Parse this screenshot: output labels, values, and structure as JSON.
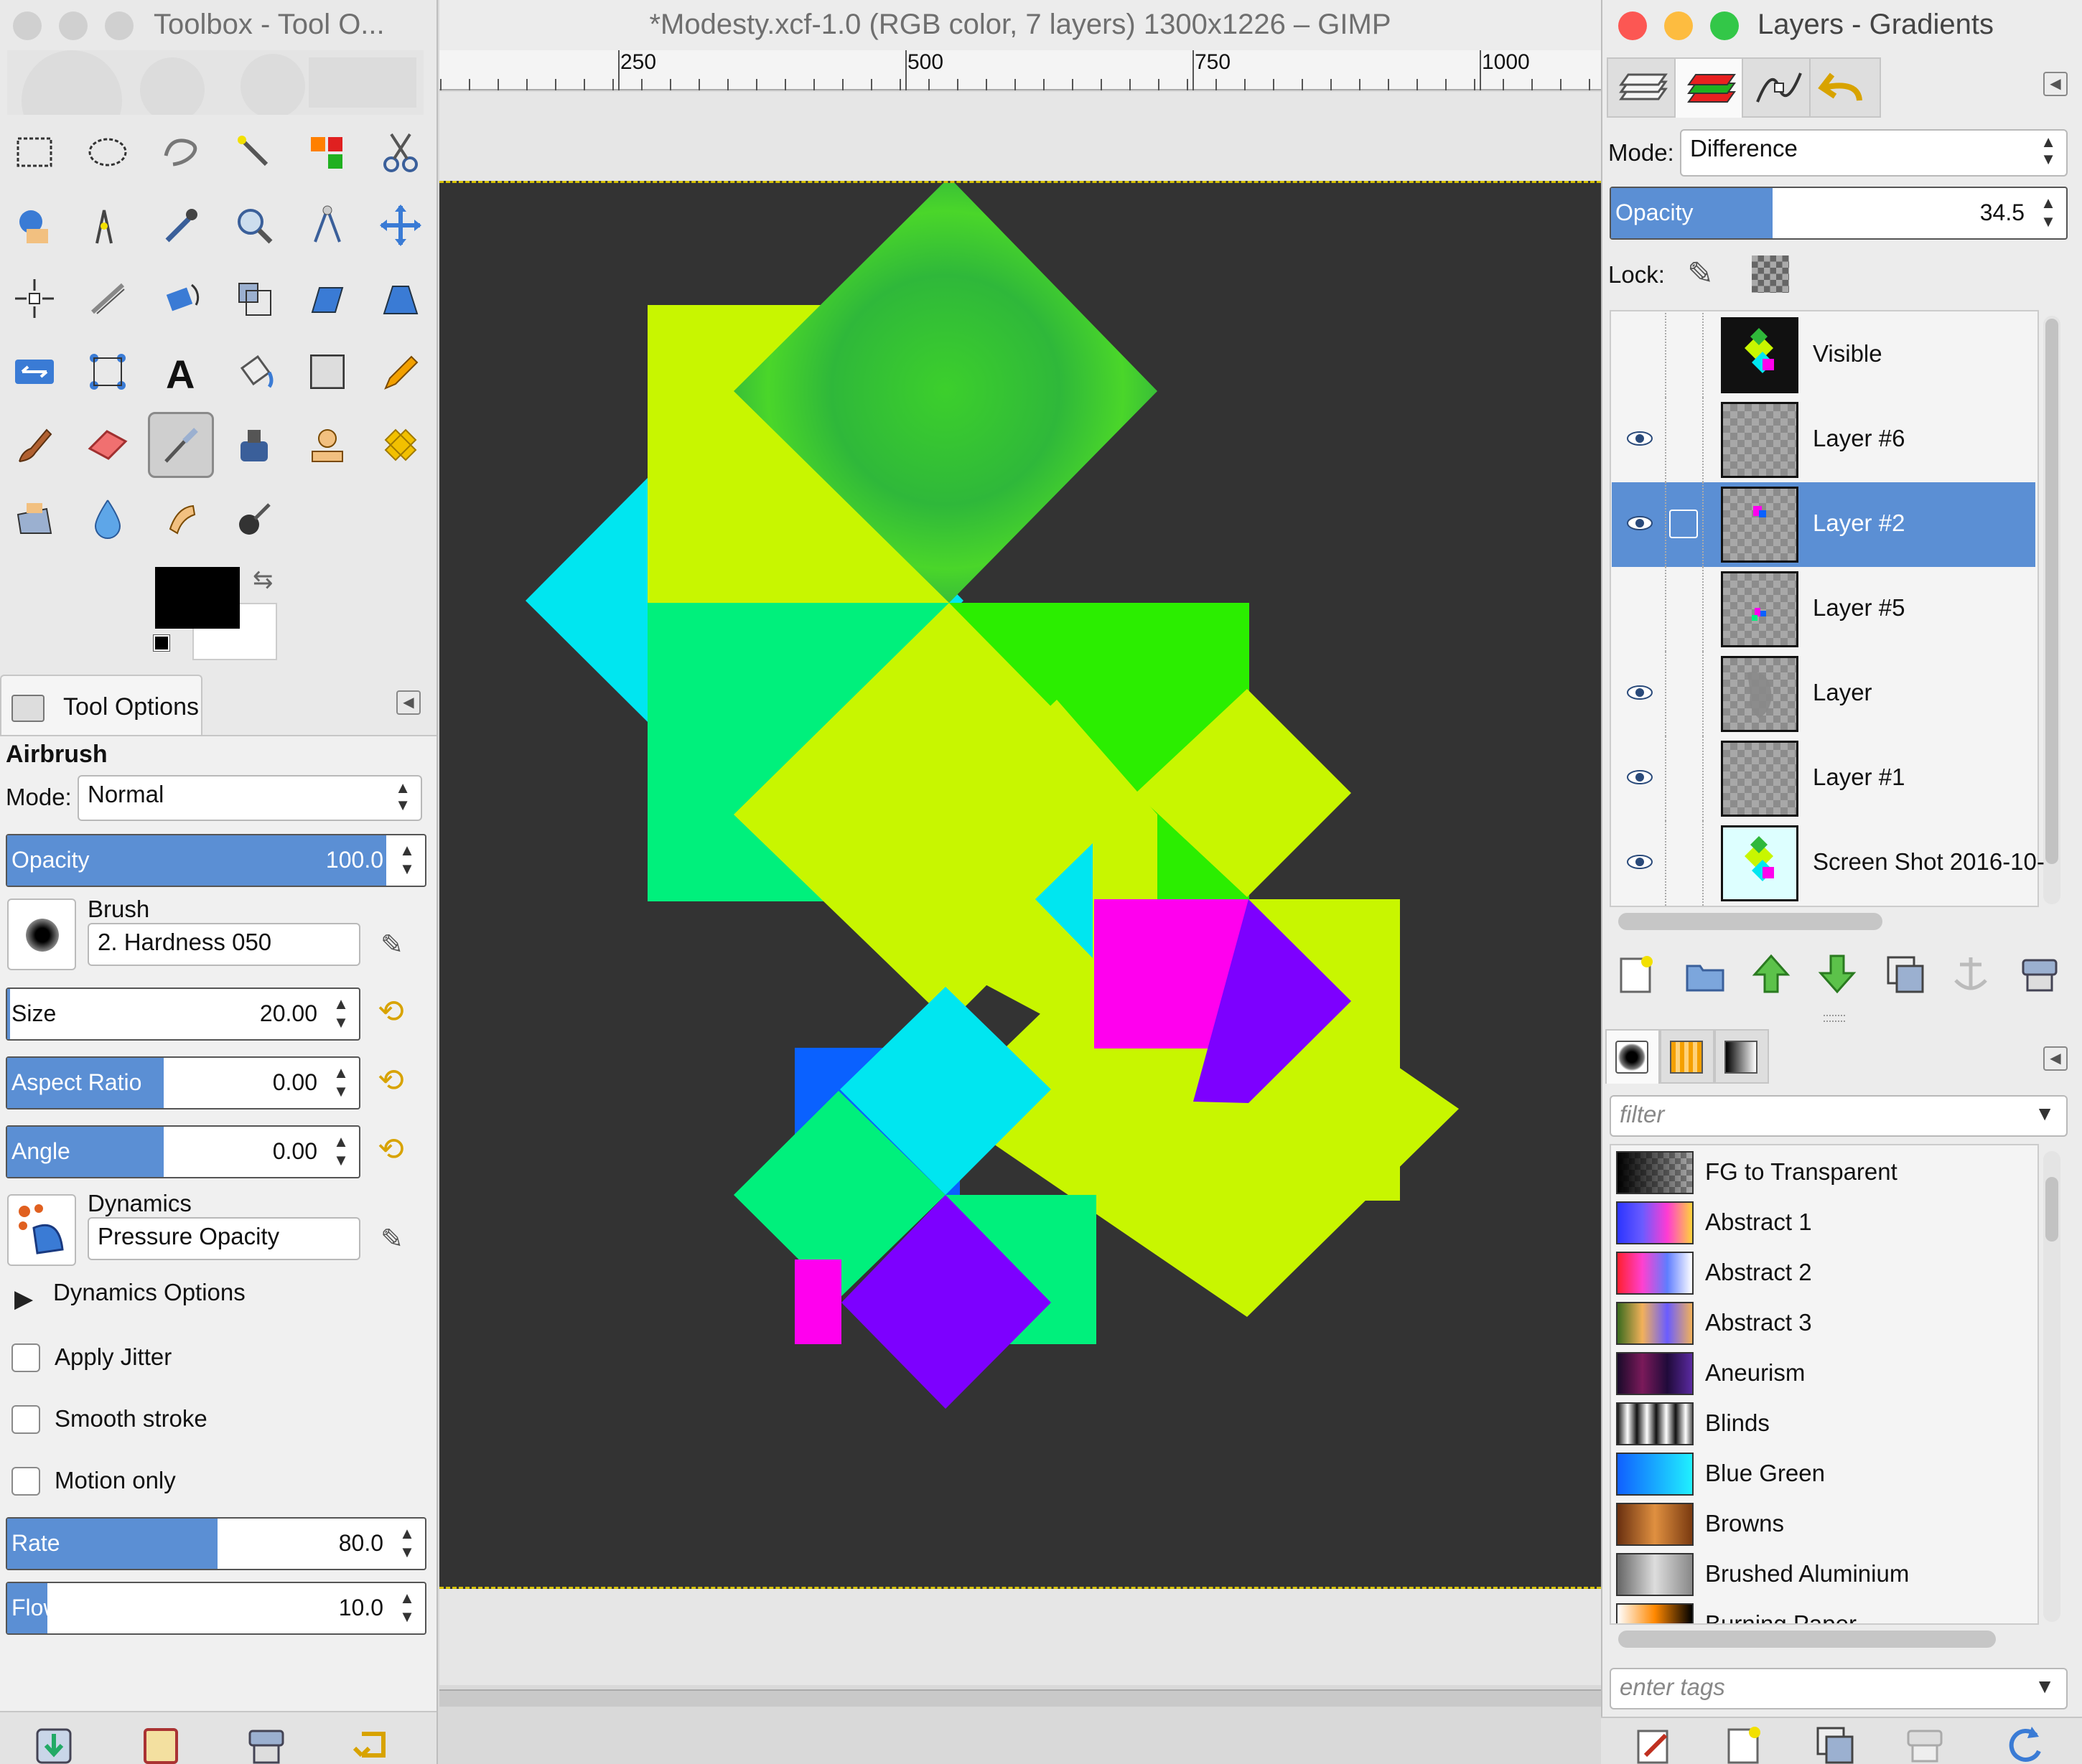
{
  "toolbox": {
    "title": "Toolbox - Tool O...",
    "tool_options_tab": "Tool Options",
    "tool_name": "Airbrush",
    "mode_label": "Mode:",
    "mode_value": "Normal",
    "opacity": {
      "label": "Opacity",
      "value": "100.0",
      "fraction": 1.0
    },
    "brush_label": "Brush",
    "brush_value": "2. Hardness 050",
    "size": {
      "label": "Size",
      "value": "20.00",
      "fraction": 0.01
    },
    "aspect_ratio": {
      "label": "Aspect Ratio",
      "value": "0.00",
      "fraction": 0.5
    },
    "angle": {
      "label": "Angle",
      "value": "0.00",
      "fraction": 0.5
    },
    "dynamics_label": "Dynamics",
    "dynamics_value": "Pressure Opacity",
    "dynamics_options": "Dynamics Options",
    "apply_jitter": "Apply Jitter",
    "smooth_stroke": "Smooth stroke",
    "motion_only": "Motion only",
    "rate": {
      "label": "Rate",
      "value": "80.0",
      "fraction": 0.52
    },
    "flow": {
      "label": "Flow",
      "value": "10.0",
      "fraction": 0.1
    }
  },
  "canvas": {
    "title": "*Modesty.xcf-1.0 (RGB color, 7 layers) 1300x1226 – GIMP",
    "ruler_marks": [
      "250",
      "500",
      "750",
      "1000"
    ]
  },
  "layers": {
    "title": "Layers - Gradients",
    "mode_label": "Mode:",
    "mode_value": "Difference",
    "opacity": {
      "label": "Opacity",
      "value": "34.5",
      "fraction": 0.345
    },
    "lock_label": "Lock:",
    "items": [
      {
        "name": "Visible",
        "visible": false,
        "selected": false
      },
      {
        "name": "Layer #6",
        "visible": true,
        "selected": false
      },
      {
        "name": "Layer #2",
        "visible": true,
        "selected": true
      },
      {
        "name": "Layer #5",
        "visible": false,
        "selected": false
      },
      {
        "name": "Layer",
        "visible": true,
        "selected": false
      },
      {
        "name": "Layer #1",
        "visible": true,
        "selected": false
      },
      {
        "name": "Screen Shot 2016-10-",
        "visible": true,
        "selected": false
      }
    ]
  },
  "gradients": {
    "filter_placeholder": "filter",
    "tags_placeholder": "enter tags",
    "items": [
      {
        "name": "FG to Transparent",
        "colors": [
          "#000000",
          "#777777"
        ]
      },
      {
        "name": "Abstract 1",
        "colors": [
          "#2c35ff",
          "#6a5bff",
          "#ff3bd3",
          "#ffd23b"
        ]
      },
      {
        "name": "Abstract 2",
        "colors": [
          "#ff2030",
          "#ff40d0",
          "#5f7dff",
          "#ffffff"
        ]
      },
      {
        "name": "Abstract 3",
        "colors": [
          "#3a6b1e",
          "#f2b15a",
          "#6a5cff",
          "#f2b15a"
        ]
      },
      {
        "name": "Aneurism",
        "colors": [
          "#1a0a2a",
          "#7a1a5a",
          "#200a3a",
          "#5a2aa0"
        ]
      },
      {
        "name": "Blinds",
        "colors": [
          "#111111",
          "#ffffff",
          "#111111",
          "#ffffff"
        ]
      },
      {
        "name": "Blue Green",
        "colors": [
          "#1060ff",
          "#20f0ff"
        ]
      },
      {
        "name": "Browns",
        "colors": [
          "#6a3010",
          "#e09040",
          "#7a3a10"
        ]
      },
      {
        "name": "Brushed Aluminium",
        "colors": [
          "#666666",
          "#dddddd",
          "#888888"
        ]
      },
      {
        "name": "Burning Paper",
        "colors": [
          "#ffffff",
          "#ff8800",
          "#000000"
        ]
      }
    ]
  }
}
